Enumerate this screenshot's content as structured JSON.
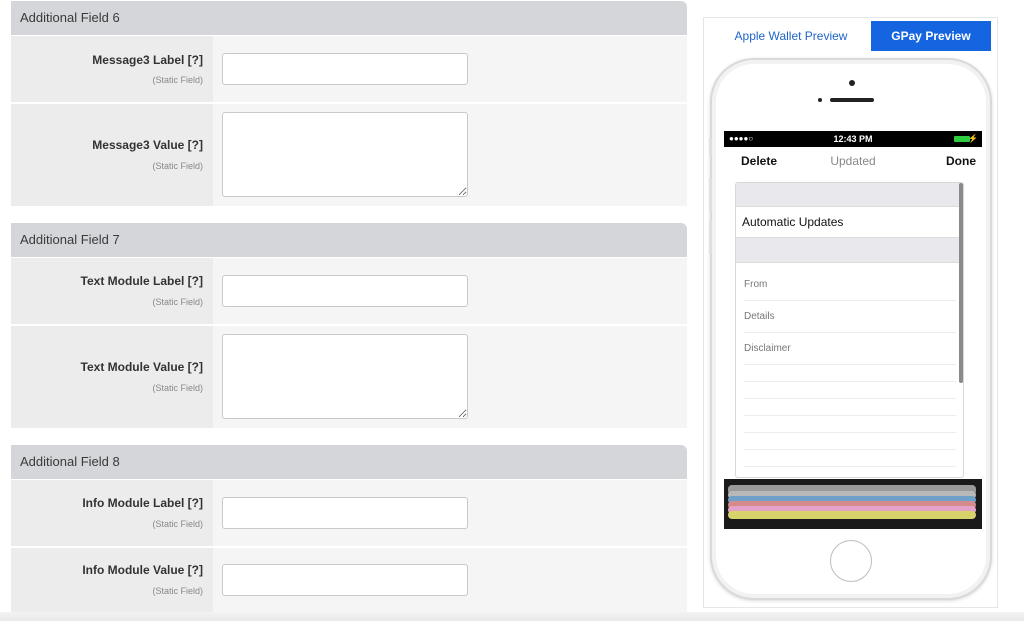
{
  "form": {
    "sections": [
      {
        "title": "Additional Field 6",
        "fields": [
          {
            "label": "Message3 Label [?]",
            "sub": "(Static Field)",
            "type": "input",
            "value": ""
          },
          {
            "label": "Message3 Value [?]",
            "sub": "(Static Field)",
            "type": "textarea",
            "value": ""
          }
        ]
      },
      {
        "title": "Additional Field 7",
        "fields": [
          {
            "label": "Text Module Label [?]",
            "sub": "(Static Field)",
            "type": "input",
            "value": ""
          },
          {
            "label": "Text Module Value [?]",
            "sub": "(Static Field)",
            "type": "textarea",
            "value": ""
          }
        ]
      },
      {
        "title": "Additional Field 8",
        "fields": [
          {
            "label": "Info Module Label [?]",
            "sub": "(Static Field)",
            "type": "input",
            "value": ""
          },
          {
            "label": "Info Module Value [?]",
            "sub": "(Static Field)",
            "type": "input",
            "value": ""
          }
        ]
      }
    ]
  },
  "preview": {
    "tabs": [
      {
        "label": "Apple Wallet Preview",
        "active": false
      },
      {
        "label": "GPay Preview",
        "active": true
      }
    ],
    "phone": {
      "status": {
        "signal": "●●●●○",
        "time": "12:43 PM",
        "bolt": "⚡"
      },
      "nav": {
        "left": "Delete",
        "title": "Updated",
        "right": "Done"
      },
      "toggle_label": "Automatic Updates",
      "back_items": [
        "From",
        "Details",
        "Disclaimer"
      ],
      "stack_colors": [
        "#9a9a9a",
        "#b8b8b8",
        "#6fa0c8",
        "#d58b8b",
        "#e5a2c8",
        "#d7d36b"
      ]
    },
    "accent_color": "#1565e0"
  }
}
